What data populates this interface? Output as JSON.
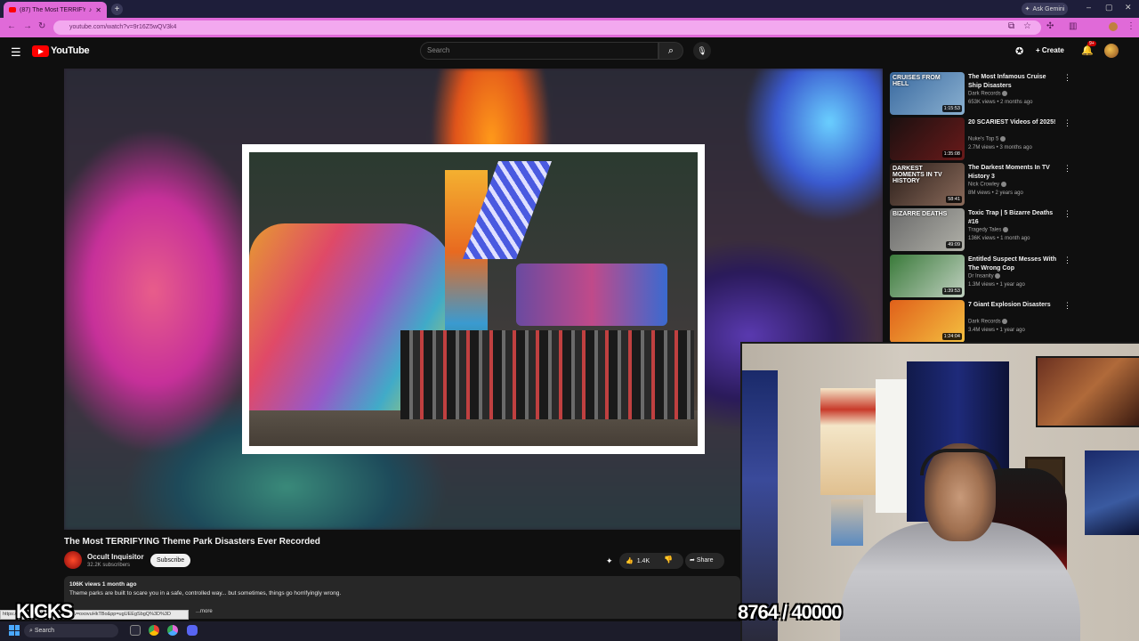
{
  "browser": {
    "tab_title": "(87) The Most TERRIFYING...",
    "new_tab": "+",
    "ask_gemini": "Ask Gemini",
    "url": "youtube.com/watch?v=9r16Z5wQV3k4",
    "window_controls": [
      "–",
      "▢",
      "✕"
    ]
  },
  "header": {
    "logo_text": "YouTube",
    "search_placeholder": "Search",
    "create_label": "Create",
    "notification_count": "9+"
  },
  "video": {
    "title": "The Most TERRIFYING Theme Park Disasters Ever Recorded",
    "channel": "Occult Inquisitor",
    "subscribers": "32.2K subscribers",
    "subscribe_label": "Subscribe",
    "likes": "1.4K",
    "share_label": "Share",
    "views_date": "106K views  1 month ago",
    "description": "Theme parks are built to scare you in a safe, controlled way... but sometimes, things go horrifyingly wrong.",
    "more_label": "...more",
    "status_url": "https://www.youtube.com/watch?v=oxovuHkTBo&pp=ugUEEgSbgQ%3D%3D"
  },
  "recommendations": [
    {
      "title": "The Most Infamous Cruise Ship Disasters",
      "channel": "Dark Records",
      "meta": "653K views • 2 months ago",
      "duration": "1:15:53",
      "thumb_text": "CRUISES FROM HELL",
      "colors": [
        "#3a6aa0",
        "#8ab0d0"
      ]
    },
    {
      "title": "20 SCARIEST Videos of 2025!",
      "channel": "Nuke's Top 5",
      "meta": "2.7M views • 3 months ago",
      "duration": "1:35:08",
      "thumb_text": "",
      "colors": [
        "#1a1010",
        "#6a1a1a"
      ]
    },
    {
      "title": "The Darkest Moments In TV History 3",
      "channel": "Nick Crowley",
      "meta": "8M views • 2 years ago",
      "duration": "58:41",
      "thumb_text": "DARKEST MOMENTS IN TV HISTORY",
      "colors": [
        "#2a1e1a",
        "#8a6a5a"
      ]
    },
    {
      "title": "Toxic Trap | 5 Bizarre Deaths #16",
      "channel": "Tragedy Tales",
      "meta": "136K views • 1 month ago",
      "duration": "49:09",
      "thumb_text": "BIZARRE DEATHS",
      "colors": [
        "#6a6a6a",
        "#b0b0a8"
      ]
    },
    {
      "title": "Entitled Suspect Messes With The Wrong Cop",
      "channel": "Dr Insanity",
      "meta": "1.3M views • 1 year ago",
      "duration": "1:39:53",
      "thumb_text": "",
      "colors": [
        "#3a7a3a",
        "#c0d0c0"
      ]
    },
    {
      "title": "7 Giant Explosion Disasters",
      "channel": "Dark Records",
      "meta": "3.4M views • 1 year ago",
      "duration": "1:24:04",
      "thumb_text": "",
      "colors": [
        "#e0601a",
        "#f4c040"
      ]
    }
  ],
  "overlay": {
    "kicks_label": "KICKS",
    "counter": "8764 / 40000"
  },
  "taskbar": {
    "search_label": "Search"
  },
  "colors": {
    "browser_accent": "#e06ad8",
    "youtube_red": "#ff0000",
    "background": "#0f0f0f"
  }
}
